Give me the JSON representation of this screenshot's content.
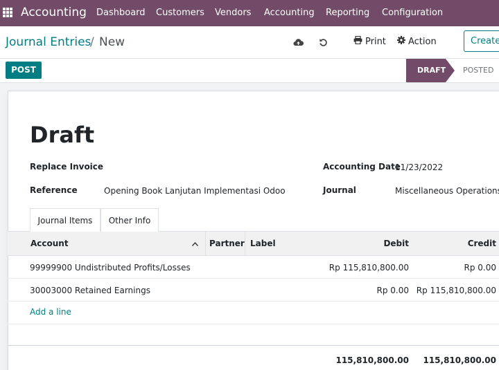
{
  "nav": {
    "app_title": "Accounting",
    "menu": [
      "Dashboard",
      "Customers",
      "Vendors",
      "Accounting",
      "Reporting",
      "Configuration"
    ]
  },
  "control_panel": {
    "breadcrumb_root": "Journal Entries",
    "breadcrumb_separator": "/",
    "breadcrumb_current": "New",
    "print_label": "Print",
    "action_label": "Action",
    "create_label": "Create",
    "icons": [
      "cloud-upload-icon",
      "undo-icon",
      "printer-icon",
      "gear-icon"
    ]
  },
  "statusbar": {
    "post_label": "POST",
    "stages": [
      "DRAFT",
      "POSTED"
    ],
    "active_stage": "DRAFT"
  },
  "form": {
    "title": "Draft",
    "replace_invoice_label": "Replace Invoice",
    "reference_label": "Reference",
    "reference_value": "Opening Book Lanjutan Implementasi Odoo",
    "accounting_date_label": "Accounting Date",
    "accounting_date_value": "11/23/2022",
    "journal_label": "Journal",
    "journal_value": "Miscellaneous Operations"
  },
  "tabs": [
    "Journal Items",
    "Other Info"
  ],
  "table": {
    "headers": [
      "Account",
      "Partner",
      "Label",
      "Debit",
      "Credit"
    ],
    "rows": [
      {
        "account": "99999900 Undistributed Profits/Losses",
        "debit": "Rp 115,810,800.00",
        "credit": "Rp 0.00"
      },
      {
        "account": "30003000 Retained Earnings",
        "debit": "Rp 0.00",
        "credit": "Rp 115,810,800.00"
      }
    ],
    "add_line": "Add a line",
    "total_debit": "115,810,800.00",
    "total_credit": "115,810,800.00"
  },
  "colors": {
    "brand": "#714b67",
    "accent": "#017e84"
  }
}
